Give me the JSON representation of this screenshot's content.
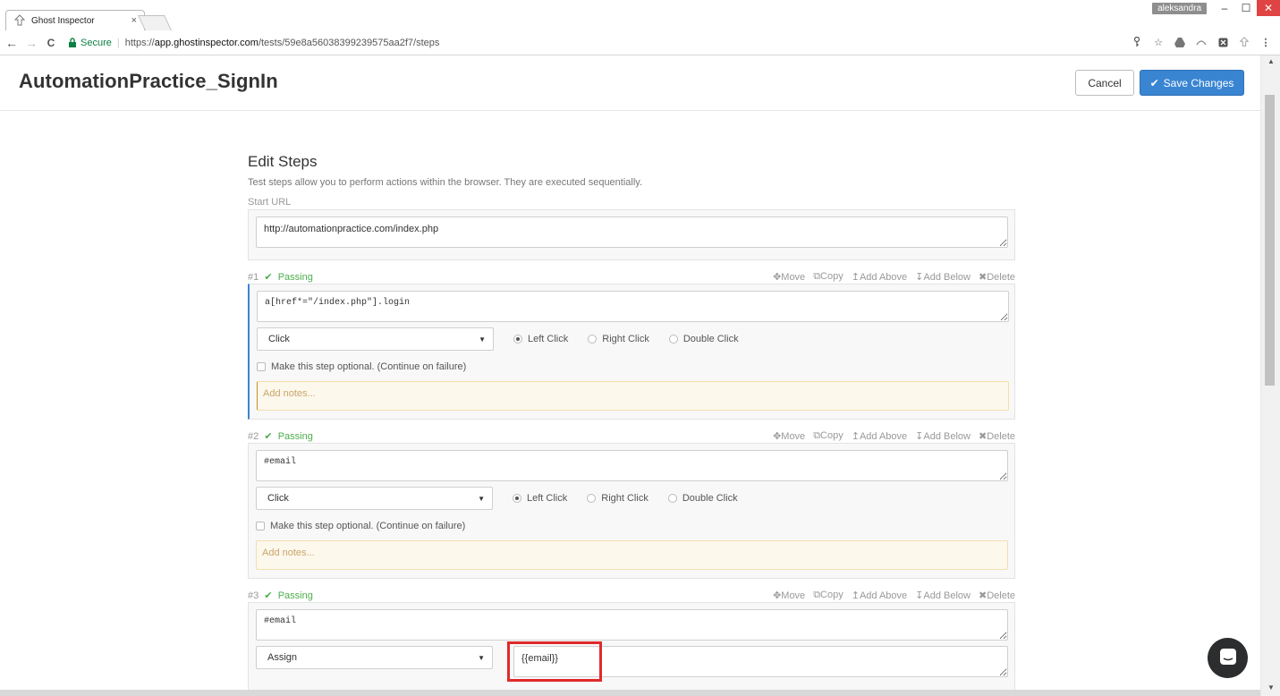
{
  "browser": {
    "tab_title": "Ghost Inspector",
    "tab_close": "×",
    "user_badge": "aleksandra",
    "window_min": "–",
    "window_max": "☐",
    "window_close": "✕",
    "secure_label": "Secure",
    "url_scheme": "https://",
    "url_host": "app.ghostinspector.com",
    "url_path": "/tests/59e8a56038399239575aa2f7/steps",
    "nav_back": "←",
    "nav_forward": "→",
    "nav_reload": "C"
  },
  "header": {
    "title": "AutomationPractice_SignIn",
    "cancel_label": "Cancel",
    "save_label": "Save Changes"
  },
  "edit_steps": {
    "title": "Edit Steps",
    "description": "Test steps allow you to perform actions within the browser. They are executed sequentially.",
    "start_url_label": "Start URL",
    "start_url_value": "http://automationpractice.com/index.php"
  },
  "step_actions": {
    "move": "Move",
    "copy": "Copy",
    "add_above": "Add Above",
    "add_below": "Add Below",
    "delete": "Delete"
  },
  "steps": [
    {
      "number": "#1",
      "status": "Passing",
      "selector": "a[href*=\"/index.php\"].login",
      "action": "Click",
      "radios": [
        "Left Click",
        "Right Click",
        "Double Click"
      ],
      "optional_label": "Make this step optional. (Continue on failure)",
      "notes_placeholder": "Add notes..."
    },
    {
      "number": "#2",
      "status": "Passing",
      "selector": "#email",
      "action": "Click",
      "radios": [
        "Left Click",
        "Right Click",
        "Double Click"
      ],
      "optional_label": "Make this step optional. (Continue on failure)",
      "notes_placeholder": "Add notes..."
    },
    {
      "number": "#3",
      "status": "Passing",
      "selector": "#email",
      "action": "Assign",
      "value": "{{email}}"
    }
  ],
  "colors": {
    "accent_blue": "#3a85d2",
    "passing_green": "#4cae4c",
    "highlight_red": "#e02a2a"
  }
}
